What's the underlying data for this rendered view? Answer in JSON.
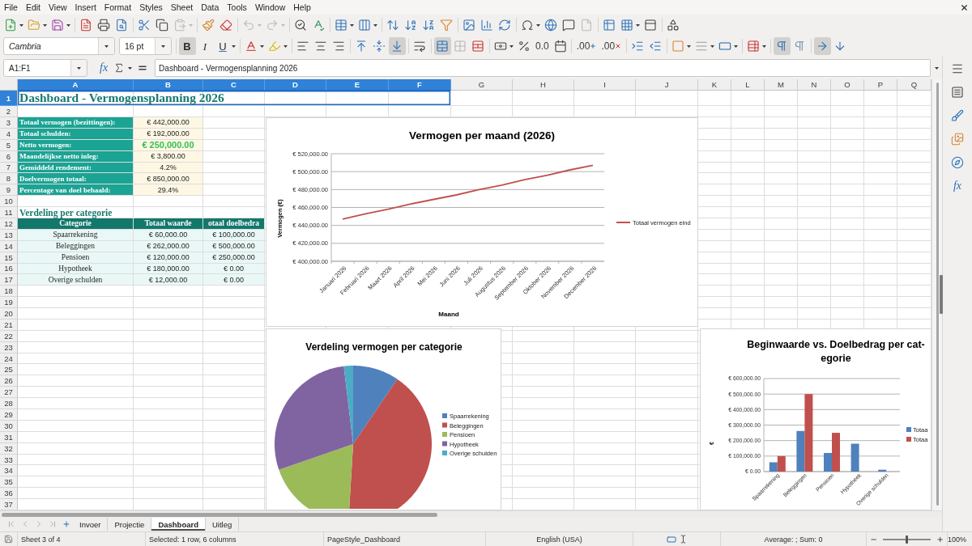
{
  "menu_bar": [
    "File",
    "Edit",
    "View",
    "Insert",
    "Format",
    "Styles",
    "Sheet",
    "Data",
    "Tools",
    "Window",
    "Help"
  ],
  "standard_toolbar": {
    "buttons": [
      {
        "disabled": false
      },
      {
        "disabled": false
      },
      {
        "disabled": false
      },
      {
        "disabled": false
      },
      {
        "disabled": false
      },
      {
        "disabled": false
      },
      {
        "disabled": false
      },
      {
        "disabled": false
      },
      {
        "disabled": true
      },
      {
        "disabled": false
      },
      {
        "disabled": false
      },
      {
        "disabled": true
      },
      {
        "disabled": true
      },
      {
        "disabled": false
      },
      {
        "disabled": false
      },
      {
        "disabled": false
      },
      {
        "disabled": false
      },
      {
        "disabled": false
      },
      {
        "disabled": false
      },
      {
        "disabled": false
      },
      {
        "disabled": false
      },
      {
        "disabled": false
      },
      {
        "disabled": false
      },
      {
        "disabled": false
      },
      {
        "disabled": false
      },
      {
        "disabled": false
      },
      {
        "disabled": false
      },
      {
        "disabled": true
      },
      {
        "disabled": false
      },
      {
        "disabled": false
      },
      {
        "disabled": false
      },
      {
        "disabled": false
      }
    ]
  },
  "formatting_toolbar": {
    "font_name": "Cambria",
    "font_size": "16 pt",
    "style_toggles": [
      {
        "label": "B",
        "on": true
      },
      {
        "label": "I",
        "on": false
      },
      {
        "label": "U",
        "on": false
      }
    ],
    "horizontal_align": [
      {
        "selected": false
      },
      {
        "selected": false
      },
      {
        "selected": false
      }
    ],
    "vertical_align": [
      {
        "selected": false
      },
      {
        "selected": false
      },
      {
        "selected": true
      }
    ],
    "merge_and_center": {
      "on": true
    },
    "number_format_label": "0.0",
    "decimal_buttons": [
      {
        "label": ".00"
      },
      {
        "label": ".00"
      }
    ],
    "paragraph_direction": [
      {
        "selected": true
      },
      {
        "selected": false
      }
    ],
    "text_direction": [
      {
        "selected": true
      },
      {
        "selected": false
      }
    ]
  },
  "formula_bar": {
    "name_box": "A1:F1",
    "function_wizard": "fx",
    "content": "Dashboard - Vermogensplanning 2026"
  },
  "sidebar": {
    "functions_button": "fx"
  },
  "sheet": {
    "columns": [
      {
        "label": "A",
        "selected": true
      },
      {
        "label": "B",
        "selected": true
      },
      {
        "label": "C",
        "selected": true
      },
      {
        "label": "D",
        "selected": true
      },
      {
        "label": "E",
        "selected": true
      },
      {
        "label": "F",
        "selected": true
      },
      {
        "label": "G",
        "selected": false
      },
      {
        "label": "H",
        "selected": false
      },
      {
        "label": "I",
        "selected": false
      },
      {
        "label": "J",
        "selected": false
      },
      {
        "label": "K",
        "selected": false
      },
      {
        "label": "L",
        "selected": false
      },
      {
        "label": "M",
        "selected": false
      },
      {
        "label": "N",
        "selected": false
      },
      {
        "label": "O",
        "selected": false
      },
      {
        "label": "P",
        "selected": false
      },
      {
        "label": "Q",
        "selected": false
      }
    ],
    "rows": [
      {
        "number": "1",
        "selected": true,
        "cells": [
          {
            "kind": "title",
            "text": "Dashboard - Vermogensplanning 2026",
            "selected": true
          }
        ]
      },
      {
        "number": "2",
        "selected": false
      },
      {
        "number": "3",
        "selected": false,
        "cells": [
          {
            "kind": "label",
            "text": "Totaal vermogen (bezittingen):",
            "selected": false
          },
          {
            "kind": "value",
            "text": "€ 442,000.00",
            "selected": false
          }
        ]
      },
      {
        "number": "4",
        "selected": false,
        "cells": [
          {
            "kind": "label",
            "text": "Totaal schulden:",
            "selected": false
          },
          {
            "kind": "value",
            "text": "€ 192,000.00",
            "selected": false
          }
        ]
      },
      {
        "number": "5",
        "selected": false,
        "cells": [
          {
            "kind": "label",
            "text": "Netto vermogen:",
            "selected": false
          },
          {
            "kind": "highlight",
            "text": "€ 250,000.00",
            "selected": false
          }
        ]
      },
      {
        "number": "6",
        "selected": false,
        "cells": [
          {
            "kind": "label",
            "text": "Maandelijkse netto inleg:",
            "selected": false
          },
          {
            "kind": "value",
            "text": "€ 3,800.00",
            "selected": false
          }
        ]
      },
      {
        "number": "7",
        "selected": false,
        "cells": [
          {
            "kind": "label",
            "text": "Gemiddeld rendement:",
            "selected": false
          },
          {
            "kind": "value",
            "text": "4.2%",
            "selected": false
          }
        ]
      },
      {
        "number": "8",
        "selected": false,
        "cells": [
          {
            "kind": "label",
            "text": "Doelvermogen totaal:",
            "selected": false
          },
          {
            "kind": "value",
            "text": "€ 850,000.00",
            "selected": false
          }
        ]
      },
      {
        "number": "9",
        "selected": false,
        "cells": [
          {
            "kind": "label",
            "text": "Percentage van doel behaald:",
            "selected": false
          },
          {
            "kind": "value",
            "text": "29.4%",
            "selected": false
          }
        ]
      },
      {
        "number": "10",
        "selected": false
      },
      {
        "number": "11",
        "selected": false,
        "cells": [
          {
            "kind": "section",
            "text": "Verdeling per categorie",
            "selected": false
          }
        ]
      },
      {
        "number": "12",
        "selected": false,
        "cells": [
          {
            "kind": "header",
            "text": "Categorie",
            "selected": false
          },
          {
            "kind": "header",
            "text": "Totaal waarde",
            "selected": false
          },
          {
            "kind": "header",
            "text": "otaal doelbedra",
            "selected": false
          }
        ]
      },
      {
        "number": "13",
        "selected": false,
        "cells": [
          {
            "kind": "category",
            "text": "Spaarrekening",
            "selected": false
          },
          {
            "kind": "data",
            "text": "€ 60,000.00",
            "selected": false
          },
          {
            "kind": "data",
            "text": "€ 100,000.00",
            "selected": false
          }
        ]
      },
      {
        "number": "14",
        "selected": false,
        "cells": [
          {
            "kind": "category",
            "text": "Beleggingen",
            "selected": false
          },
          {
            "kind": "data",
            "text": "€ 262,000.00",
            "selected": false
          },
          {
            "kind": "data",
            "text": "€ 500,000.00",
            "selected": false
          }
        ]
      },
      {
        "number": "15",
        "selected": false,
        "cells": [
          {
            "kind": "category",
            "text": "Pensioen",
            "selected": false
          },
          {
            "kind": "data",
            "text": "€ 120,000.00",
            "selected": false
          },
          {
            "kind": "data",
            "text": "€ 250,000.00",
            "selected": false
          }
        ]
      },
      {
        "number": "16",
        "selected": false,
        "cells": [
          {
            "kind": "category",
            "text": "Hypotheek",
            "selected": false
          },
          {
            "kind": "data",
            "text": "€ 180,000.00",
            "selected": false
          },
          {
            "kind": "data",
            "text": "€ 0.00",
            "selected": false
          }
        ]
      },
      {
        "number": "17",
        "selected": false,
        "cells": [
          {
            "kind": "category",
            "text": "Overige schulden",
            "selected": false
          },
          {
            "kind": "data",
            "text": "€ 12,000.00",
            "selected": false
          },
          {
            "kind": "data",
            "text": "€ 0.00",
            "selected": false
          }
        ]
      },
      {
        "number": "18",
        "selected": false
      },
      {
        "number": "19",
        "selected": false
      },
      {
        "number": "20",
        "selected": false
      },
      {
        "number": "21",
        "selected": false
      },
      {
        "number": "22",
        "selected": false
      },
      {
        "number": "23",
        "selected": false
      },
      {
        "number": "24",
        "selected": false
      },
      {
        "number": "25",
        "selected": false
      },
      {
        "number": "26",
        "selected": false
      },
      {
        "number": "27",
        "selected": false
      },
      {
        "number": "28",
        "selected": false
      },
      {
        "number": "29",
        "selected": false
      },
      {
        "number": "30",
        "selected": false
      },
      {
        "number": "31",
        "selected": false
      },
      {
        "number": "32",
        "selected": false
      },
      {
        "number": "33",
        "selected": false
      },
      {
        "number": "34",
        "selected": false
      },
      {
        "number": "35",
        "selected": false
      },
      {
        "number": "36",
        "selected": false
      },
      {
        "number": "37",
        "selected": false
      }
    ],
    "charts": [
      {
        "chart_data": {
          "type": "line",
          "title": "Vermogen per maand (2026)",
          "xlabel": "Maand",
          "ylabel": "Vermogen (€)",
          "categories": [
            "Januari 2026",
            "Februari 2026",
            "Maart 2026",
            "April 2026",
            "Mei 2026",
            "Juni 2026",
            "Juli 2026",
            "Augustus 2026",
            "September 2026",
            "Oktober 2026",
            "November 2026",
            "December 2026"
          ],
          "series": [
            {
              "name": "Totaal vermogen eind",
              "color": "#c0504d",
              "values": [
                447000,
                453000,
                458000,
                464000,
                469000,
                474000,
                480000,
                485000,
                491000,
                496000,
                502000,
                507000
              ]
            }
          ],
          "ylim": [
            400000,
            520000
          ],
          "yticks": [
            {
              "value": 400000,
              "label": "€ 400,000.00"
            },
            {
              "value": 420000,
              "label": "€ 420,000.00"
            },
            {
              "value": 440000,
              "label": "€ 440,000.00"
            },
            {
              "value": 460000,
              "label": "€ 460,000.00"
            },
            {
              "value": 480000,
              "label": "€ 480,000.00"
            },
            {
              "value": 500000,
              "label": "€ 500,000.00"
            },
            {
              "value": 520000,
              "label": "€ 520,000.00"
            }
          ],
          "grid": true,
          "legend": true
        }
      },
      {
        "chart_data": {
          "type": "pie",
          "title": "Verdeling vermogen per categorie",
          "categories": [
            "Spaarrekening",
            "Beleggingen",
            "Pensioen",
            "Hypotheek",
            "Overige schulden"
          ],
          "values": [
            9.5,
            41.3,
            18.9,
            28.4,
            1.9
          ],
          "legend": true
        }
      },
      {
        "chart_data": {
          "type": "bar",
          "title": "Beginwaarde vs. Doelbedrag per cat-egorie",
          "ylabel": "€",
          "categories": [
            "Spaarrekening",
            "Beleggingen",
            "Pensioen",
            "Hypotheek",
            "Overige schulden"
          ],
          "series": [
            {
              "name": "Totaa",
              "color": "#4f81bd",
              "values": [
                60000,
                262000,
                120000,
                180000,
                12000
              ]
            },
            {
              "name": "Totaa",
              "color": "#c0504d",
              "values": [
                100000,
                500000,
                250000,
                0,
                0
              ]
            }
          ],
          "ylim": [
            0,
            600000
          ],
          "yticks": [
            {
              "value": 0,
              "label": "€ 0.00"
            },
            {
              "value": 100000,
              "label": "€ 100,000.00"
            },
            {
              "value": 200000,
              "label": "€ 200,000.00"
            },
            {
              "value": 300000,
              "label": "€ 300,000.00"
            },
            {
              "value": 400000,
              "label": "€ 400,000.00"
            },
            {
              "value": 500000,
              "label": "€ 500,000.00"
            },
            {
              "value": 600000,
              "label": "€ 600,000.00"
            }
          ],
          "grid": true,
          "legend": true
        }
      }
    ]
  },
  "sheet_tabs": [
    {
      "label": "Invoer",
      "selected": false
    },
    {
      "label": "Projectie",
      "selected": false
    },
    {
      "label": "Dashboard",
      "selected": true
    },
    {
      "label": "Uitleg",
      "selected": false
    }
  ],
  "status_bar": {
    "sheet": "Sheet 3 of 4",
    "selection": "Selected: 1 row, 6 columns",
    "page_style": "PageStyle_Dashboard",
    "language": "English (USA)",
    "summary": "Average: ; Sum: 0",
    "zoom": {
      "level": 0.5,
      "label": "100%"
    }
  }
}
